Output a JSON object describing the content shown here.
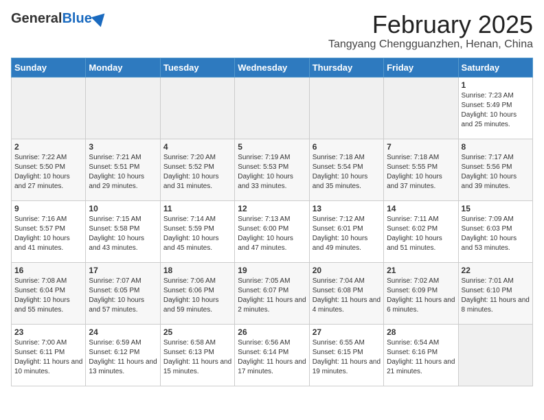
{
  "header": {
    "logo_general": "General",
    "logo_blue": "Blue",
    "title": "February 2025",
    "subtitle": "Tangyang Chengguanzhen, Henan, China"
  },
  "days_of_week": [
    "Sunday",
    "Monday",
    "Tuesday",
    "Wednesday",
    "Thursday",
    "Friday",
    "Saturday"
  ],
  "weeks": [
    [
      {
        "day": "",
        "info": ""
      },
      {
        "day": "",
        "info": ""
      },
      {
        "day": "",
        "info": ""
      },
      {
        "day": "",
        "info": ""
      },
      {
        "day": "",
        "info": ""
      },
      {
        "day": "",
        "info": ""
      },
      {
        "day": "1",
        "info": "Sunrise: 7:23 AM\nSunset: 5:49 PM\nDaylight: 10 hours and 25 minutes."
      }
    ],
    [
      {
        "day": "2",
        "info": "Sunrise: 7:22 AM\nSunset: 5:50 PM\nDaylight: 10 hours and 27 minutes."
      },
      {
        "day": "3",
        "info": "Sunrise: 7:21 AM\nSunset: 5:51 PM\nDaylight: 10 hours and 29 minutes."
      },
      {
        "day": "4",
        "info": "Sunrise: 7:20 AM\nSunset: 5:52 PM\nDaylight: 10 hours and 31 minutes."
      },
      {
        "day": "5",
        "info": "Sunrise: 7:19 AM\nSunset: 5:53 PM\nDaylight: 10 hours and 33 minutes."
      },
      {
        "day": "6",
        "info": "Sunrise: 7:18 AM\nSunset: 5:54 PM\nDaylight: 10 hours and 35 minutes."
      },
      {
        "day": "7",
        "info": "Sunrise: 7:18 AM\nSunset: 5:55 PM\nDaylight: 10 hours and 37 minutes."
      },
      {
        "day": "8",
        "info": "Sunrise: 7:17 AM\nSunset: 5:56 PM\nDaylight: 10 hours and 39 minutes."
      }
    ],
    [
      {
        "day": "9",
        "info": "Sunrise: 7:16 AM\nSunset: 5:57 PM\nDaylight: 10 hours and 41 minutes."
      },
      {
        "day": "10",
        "info": "Sunrise: 7:15 AM\nSunset: 5:58 PM\nDaylight: 10 hours and 43 minutes."
      },
      {
        "day": "11",
        "info": "Sunrise: 7:14 AM\nSunset: 5:59 PM\nDaylight: 10 hours and 45 minutes."
      },
      {
        "day": "12",
        "info": "Sunrise: 7:13 AM\nSunset: 6:00 PM\nDaylight: 10 hours and 47 minutes."
      },
      {
        "day": "13",
        "info": "Sunrise: 7:12 AM\nSunset: 6:01 PM\nDaylight: 10 hours and 49 minutes."
      },
      {
        "day": "14",
        "info": "Sunrise: 7:11 AM\nSunset: 6:02 PM\nDaylight: 10 hours and 51 minutes."
      },
      {
        "day": "15",
        "info": "Sunrise: 7:09 AM\nSunset: 6:03 PM\nDaylight: 10 hours and 53 minutes."
      }
    ],
    [
      {
        "day": "16",
        "info": "Sunrise: 7:08 AM\nSunset: 6:04 PM\nDaylight: 10 hours and 55 minutes."
      },
      {
        "day": "17",
        "info": "Sunrise: 7:07 AM\nSunset: 6:05 PM\nDaylight: 10 hours and 57 minutes."
      },
      {
        "day": "18",
        "info": "Sunrise: 7:06 AM\nSunset: 6:06 PM\nDaylight: 10 hours and 59 minutes."
      },
      {
        "day": "19",
        "info": "Sunrise: 7:05 AM\nSunset: 6:07 PM\nDaylight: 11 hours and 2 minutes."
      },
      {
        "day": "20",
        "info": "Sunrise: 7:04 AM\nSunset: 6:08 PM\nDaylight: 11 hours and 4 minutes."
      },
      {
        "day": "21",
        "info": "Sunrise: 7:02 AM\nSunset: 6:09 PM\nDaylight: 11 hours and 6 minutes."
      },
      {
        "day": "22",
        "info": "Sunrise: 7:01 AM\nSunset: 6:10 PM\nDaylight: 11 hours and 8 minutes."
      }
    ],
    [
      {
        "day": "23",
        "info": "Sunrise: 7:00 AM\nSunset: 6:11 PM\nDaylight: 11 hours and 10 minutes."
      },
      {
        "day": "24",
        "info": "Sunrise: 6:59 AM\nSunset: 6:12 PM\nDaylight: 11 hours and 13 minutes."
      },
      {
        "day": "25",
        "info": "Sunrise: 6:58 AM\nSunset: 6:13 PM\nDaylight: 11 hours and 15 minutes."
      },
      {
        "day": "26",
        "info": "Sunrise: 6:56 AM\nSunset: 6:14 PM\nDaylight: 11 hours and 17 minutes."
      },
      {
        "day": "27",
        "info": "Sunrise: 6:55 AM\nSunset: 6:15 PM\nDaylight: 11 hours and 19 minutes."
      },
      {
        "day": "28",
        "info": "Sunrise: 6:54 AM\nSunset: 6:16 PM\nDaylight: 11 hours and 21 minutes."
      },
      {
        "day": "",
        "info": ""
      }
    ]
  ]
}
